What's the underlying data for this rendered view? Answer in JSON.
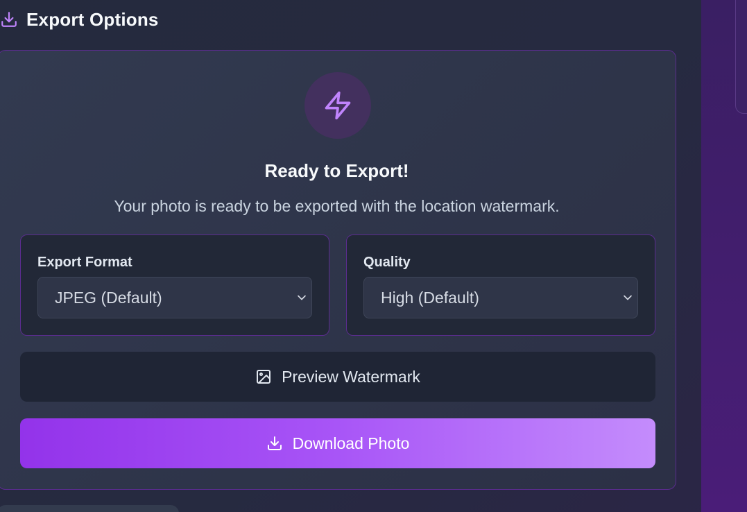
{
  "section": {
    "title": "Export Options",
    "icon": "download-icon"
  },
  "card": {
    "icon": "lightning-bolt-icon",
    "title": "Ready to Export!",
    "description": "Your photo is ready to be exported with the location watermark."
  },
  "format": {
    "label": "Export Format",
    "selected": "JPEG (Default)"
  },
  "quality": {
    "label": "Quality",
    "selected": "High (Default)"
  },
  "buttons": {
    "preview_label": "Preview Watermark",
    "preview_icon": "image-icon",
    "download_label": "Download Photo",
    "download_icon": "download-icon"
  },
  "colors": {
    "accent": "#a855f7",
    "accent_dark": "#9333ea",
    "accent_light": "#c48cfc",
    "card_border": "#5b2c8f",
    "background": "#262a40"
  }
}
